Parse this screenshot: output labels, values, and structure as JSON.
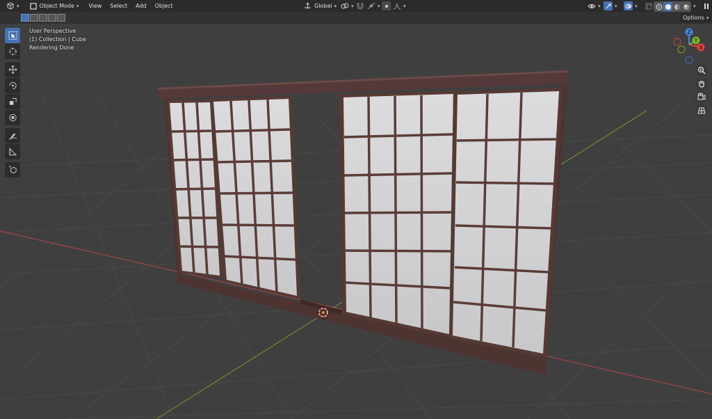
{
  "header": {
    "editor_type_icon": "editor-type-3d-viewport-icon",
    "mode_label": "Object Mode",
    "menus": [
      "View",
      "Select",
      "Add",
      "Object"
    ],
    "transform_orientation": "Global"
  },
  "subbar": {
    "options_label": "Options"
  },
  "viewport_overlay": {
    "line1": "User Perspective",
    "line2": "(1) Collection | Cube",
    "line3": "Rendering Done"
  },
  "gizmo": {
    "x_label": "X",
    "y_label": "Y",
    "z_label": "Z",
    "colors": {
      "x": "#e0413a",
      "y": "#79b52c",
      "z": "#3f8ae0"
    }
  },
  "tools": [
    "select-box-icon",
    "cursor-icon",
    "move-icon",
    "rotate-icon",
    "scale-icon",
    "transform-icon",
    "annotate-icon",
    "measure-icon",
    "add-cube-icon"
  ],
  "nav_buttons": [
    "zoom-icon",
    "hand-pan-icon",
    "camera-icon",
    "grid-ortho-icon"
  ],
  "colors": {
    "accent": "#4772b3",
    "frame_wood": "#553a33",
    "paper": "#d4d4d6",
    "grid_x_axis": "#a04545",
    "grid_y_axis": "#6c8d2e"
  }
}
